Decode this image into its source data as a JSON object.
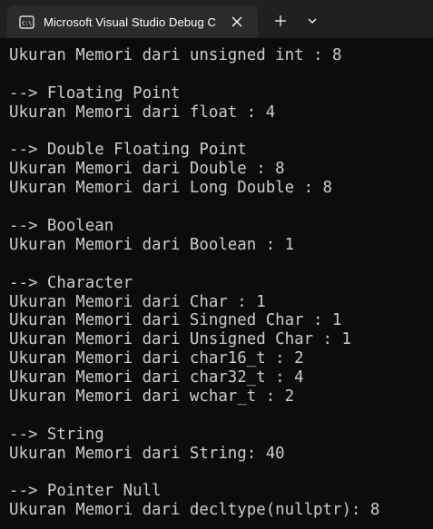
{
  "window": {
    "tab_title": "Microsoft Visual Studio Debug Console",
    "tab_icon": "terminal-icon"
  },
  "console": {
    "lines": [
      "Ukuran Memori dari unsigned int : 8",
      "",
      "--> Floating Point",
      "Ukuran Memori dari float : 4",
      "",
      "--> Double Floating Point",
      "Ukuran Memori dari Double : 8",
      "Ukuran Memori dari Long Double : 8",
      "",
      "--> Boolean",
      "Ukuran Memori dari Boolean : 1",
      "",
      "--> Character",
      "Ukuran Memori dari Char : 1",
      "Ukuran Memori dari Singned Char : 1",
      "Ukuran Memori dari Unsigned Char : 1",
      "Ukuran Memori dari char16_t : 2",
      "Ukuran Memori dari char32_t : 4",
      "Ukuran Memori dari wchar_t : 2",
      "",
      "--> String",
      "Ukuran Memori dari String: 40",
      "",
      "--> Pointer Null",
      "Ukuran Memori dari decltype(nullptr): 8"
    ]
  },
  "colors": {
    "background": "#0c0c0c",
    "titlebar": "#202020",
    "tab": "#2b2b2b",
    "text": "#cccccc"
  }
}
